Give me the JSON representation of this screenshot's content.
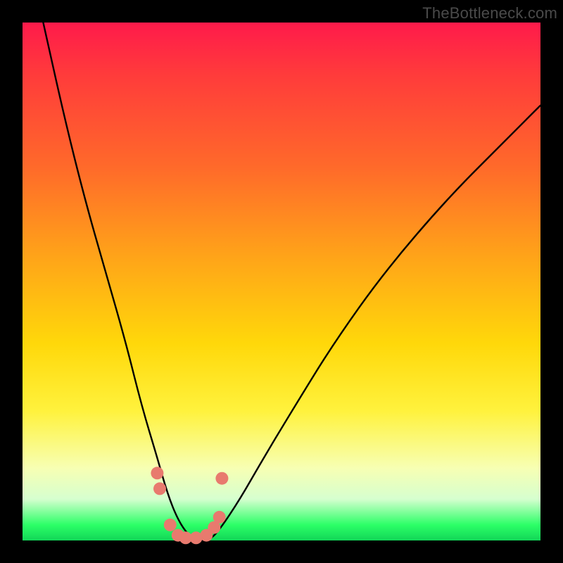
{
  "watermark": "TheBottleneck.com",
  "chart_data": {
    "type": "line",
    "title": "",
    "xlabel": "",
    "ylabel": "",
    "xlim": [
      0,
      100
    ],
    "ylim": [
      0,
      100
    ],
    "background_gradient": {
      "direction": "top-to-bottom",
      "stops": [
        {
          "position": 0,
          "color": "#ff1a4b"
        },
        {
          "position": 28,
          "color": "#ff6a2a"
        },
        {
          "position": 62,
          "color": "#ffd80a"
        },
        {
          "position": 86,
          "color": "#f7ffb3"
        },
        {
          "position": 97,
          "color": "#2cff67"
        },
        {
          "position": 100,
          "color": "#12d657"
        }
      ]
    },
    "series": [
      {
        "name": "bottleneck-curve",
        "x": [
          4,
          8,
          12,
          16,
          20,
          23,
          26,
          28,
          30,
          32,
          34,
          36,
          38,
          42,
          46,
          52,
          60,
          70,
          82,
          94,
          100
        ],
        "values": [
          100,
          82,
          66,
          52,
          38,
          26,
          16,
          9,
          4,
          1,
          0,
          0,
          2,
          8,
          15,
          25,
          38,
          52,
          66,
          78,
          84
        ]
      }
    ],
    "markers": [
      {
        "x": 26.0,
        "y": 13
      },
      {
        "x": 26.5,
        "y": 10
      },
      {
        "x": 28.5,
        "y": 3
      },
      {
        "x": 30.0,
        "y": 1
      },
      {
        "x": 31.5,
        "y": 0.5
      },
      {
        "x": 33.5,
        "y": 0.5
      },
      {
        "x": 35.5,
        "y": 1
      },
      {
        "x": 37.0,
        "y": 2.5
      },
      {
        "x": 38.0,
        "y": 4.5
      },
      {
        "x": 38.5,
        "y": 12
      }
    ]
  }
}
